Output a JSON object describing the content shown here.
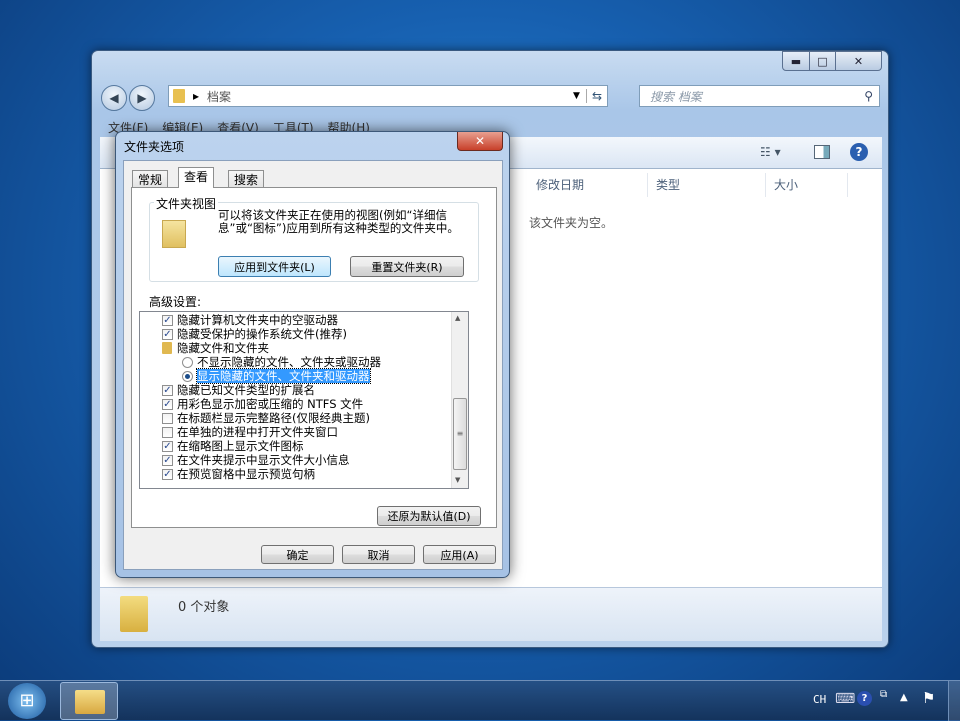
{
  "explorer": {
    "caption_buttons": {
      "minimize": "▬",
      "maximize": "□",
      "close": "✕"
    },
    "address": {
      "separator": "▸",
      "path": "档案"
    },
    "search": {
      "placeholder": "搜索 档案"
    },
    "menu": [
      "文件(F)",
      "编辑(E)",
      "查看(V)",
      "工具(T)",
      "帮助(H)"
    ],
    "columns": [
      "修改日期",
      "类型",
      "大小"
    ],
    "empty_message": "该文件夹为空。",
    "status": "0 个对象"
  },
  "dialog": {
    "title": "文件夹选项",
    "close": "✕",
    "tabs": [
      "常规",
      "查看",
      "搜索"
    ],
    "active_tab": "查看",
    "folder_views": {
      "legend": "文件夹视图",
      "description": "可以将该文件夹正在使用的视图(例如“详细信息”或“图标”)应用到所有这种类型的文件夹中。",
      "apply_button": "应用到文件夹(L)",
      "reset_button": "重置文件夹(R)"
    },
    "advanced_label": "高级设置:",
    "items": [
      {
        "type": "checkbox",
        "label": "隐藏计算机文件夹中的空驱动器",
        "checked": true
      },
      {
        "type": "checkbox",
        "label": "隐藏受保护的操作系统文件(推荐)",
        "checked": true
      },
      {
        "type": "folder",
        "label": "隐藏文件和文件夹"
      },
      {
        "type": "radio",
        "label": "不显示隐藏的文件、文件夹或驱动器",
        "checked": false
      },
      {
        "type": "radio",
        "label": "显示隐藏的文件、文件夹和驱动器",
        "checked": true,
        "selected": true
      },
      {
        "type": "checkbox",
        "label": "隐藏已知文件类型的扩展名",
        "checked": true
      },
      {
        "type": "checkbox",
        "label": "用彩色显示加密或压缩的 NTFS 文件",
        "checked": true
      },
      {
        "type": "checkbox",
        "label": "在标题栏显示完整路径(仅限经典主题)",
        "checked": false
      },
      {
        "type": "checkbox",
        "label": "在单独的进程中打开文件夹窗口",
        "checked": false
      },
      {
        "type": "checkbox",
        "label": "在缩略图上显示文件图标",
        "checked": true
      },
      {
        "type": "checkbox",
        "label": "在文件夹提示中显示文件大小信息",
        "checked": true
      },
      {
        "type": "checkbox",
        "label": "在预览窗格中显示预览句柄",
        "checked": true
      }
    ],
    "restore_defaults": "还原为默认值(D)",
    "ok": "确定",
    "cancel": "取消",
    "apply": "应用(A)"
  },
  "taskbar": {
    "language": "CH",
    "start": "⊞"
  },
  "colors": {
    "selection": "#3399ff",
    "accent": "#1c4d8a"
  }
}
